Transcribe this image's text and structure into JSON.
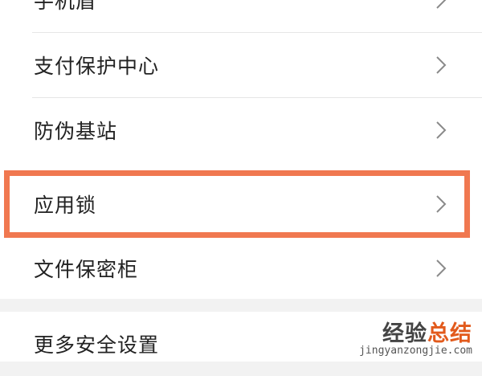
{
  "menu": {
    "items": [
      {
        "label": "手机盾",
        "chevron": "chevron-right-icon"
      },
      {
        "label": "支付保护中心",
        "chevron": "chevron-right-icon"
      },
      {
        "label": "防伪基站",
        "chevron": "chevron-right-icon"
      },
      {
        "label": "应用锁",
        "chevron": "chevron-right-icon",
        "highlighted": true
      },
      {
        "label": "文件保密柜",
        "chevron": "chevron-right-icon"
      }
    ],
    "more_settings_label": "更多安全设置"
  },
  "highlight_color": "#f07850",
  "watermark": {
    "text_part1": "经验",
    "text_part2": "总结",
    "url": "jingyanzongjie.com"
  }
}
